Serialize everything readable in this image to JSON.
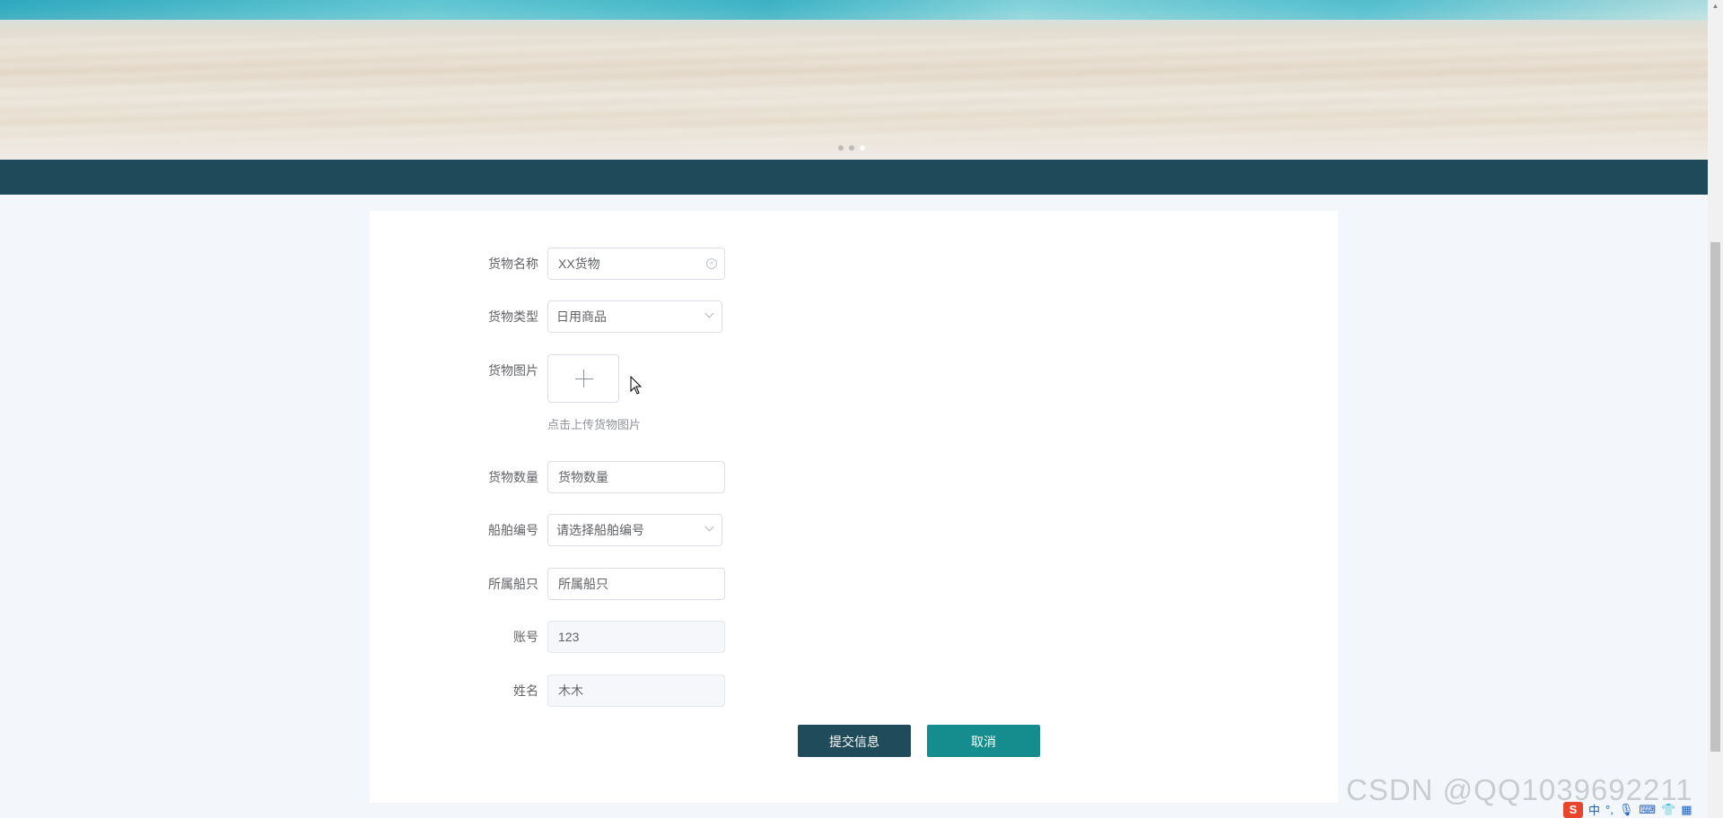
{
  "banner": {
    "slide_count": 3,
    "active_slide": 3
  },
  "form": {
    "goods_name": {
      "label": "货物名称",
      "value": "XX货物"
    },
    "goods_type": {
      "label": "货物类型",
      "value": "日用商品"
    },
    "goods_image": {
      "label": "货物图片",
      "upload_tip": "点击上传货物图片"
    },
    "goods_quantity": {
      "label": "货物数量",
      "placeholder": "货物数量"
    },
    "ship_number": {
      "label": "船舶编号",
      "placeholder": "请选择船舶编号"
    },
    "ship_owner": {
      "label": "所属船只",
      "placeholder": "所属船只"
    },
    "account": {
      "label": "账号",
      "value": "123"
    },
    "name": {
      "label": "姓名",
      "value": "木木"
    }
  },
  "actions": {
    "submit_label": "提交信息",
    "cancel_label": "取消"
  },
  "watermark": "CSDN @QQ1039692211",
  "ime": {
    "logo": "S",
    "lang": "中",
    "items": [
      "°,",
      "mic",
      "keyboard",
      "shirt",
      "grid"
    ]
  },
  "colors": {
    "nav": "#1e4a5a",
    "submit": "#1f4b5b",
    "cancel": "#158c8e"
  }
}
